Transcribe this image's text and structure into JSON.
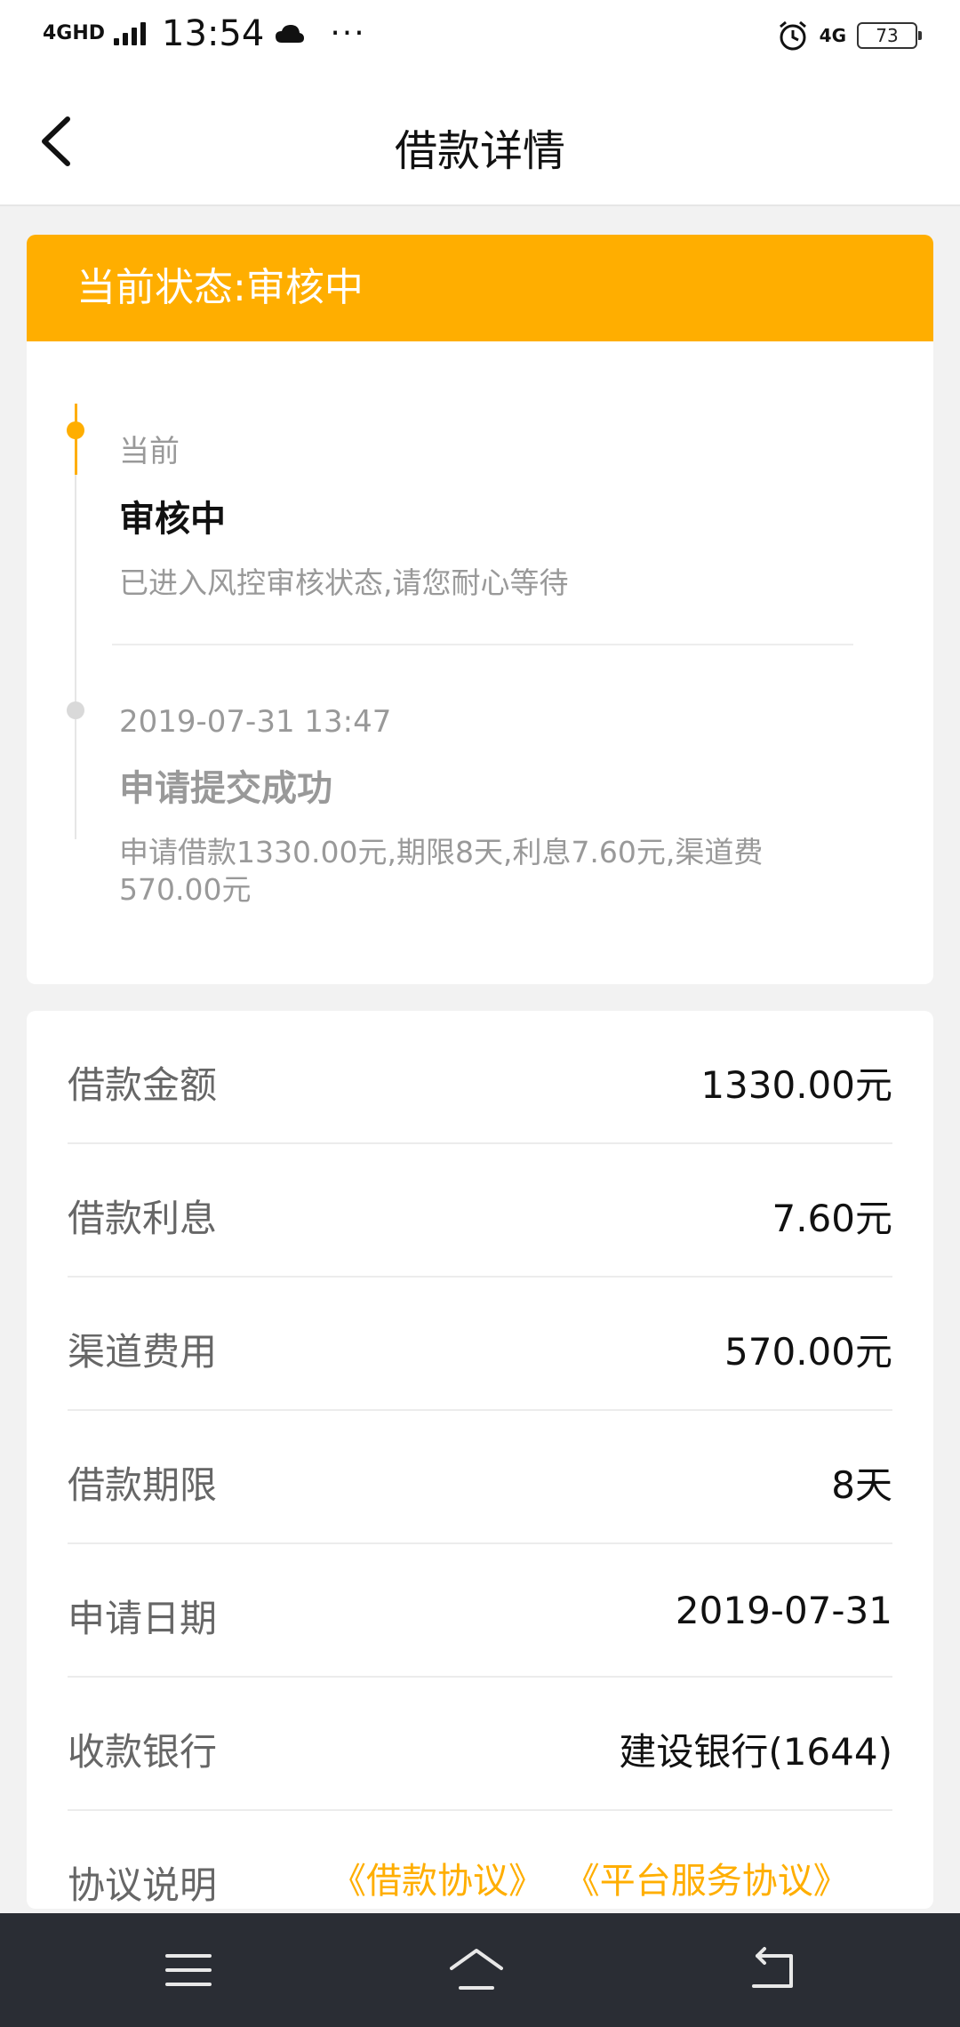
{
  "status_bar": {
    "network": "4GHD",
    "time": "13:54",
    "more": "···",
    "signal_4g": "4G",
    "battery": "73"
  },
  "header": {
    "title": "借款详情"
  },
  "status_card": {
    "status_text": "当前状态:审核中",
    "timeline": [
      {
        "sub": "当前",
        "title": "审核中",
        "desc": "已进入风控审核状态,请您耐心等待"
      },
      {
        "sub": "2019-07-31 13:47",
        "title": "申请提交成功",
        "desc": "申请借款1330.00元,期限8天,利息7.60元,渠道费570.00元"
      }
    ]
  },
  "details": {
    "rows": [
      {
        "label": "借款金额",
        "value": "1330.00元"
      },
      {
        "label": "借款利息",
        "value": "7.60元"
      },
      {
        "label": "渠道费用",
        "value": "570.00元"
      },
      {
        "label": "借款期限",
        "value": "8天"
      },
      {
        "label": "申请日期",
        "value": "2019-07-31"
      },
      {
        "label": "收款银行",
        "value": "建设银行(1644)"
      }
    ],
    "agreement_label": "协议说明",
    "agreements": [
      "《借款协议》",
      "《平台服务协议》"
    ]
  },
  "colors": {
    "accent": "#FFAE00",
    "nav_bg": "#2a2d34"
  }
}
